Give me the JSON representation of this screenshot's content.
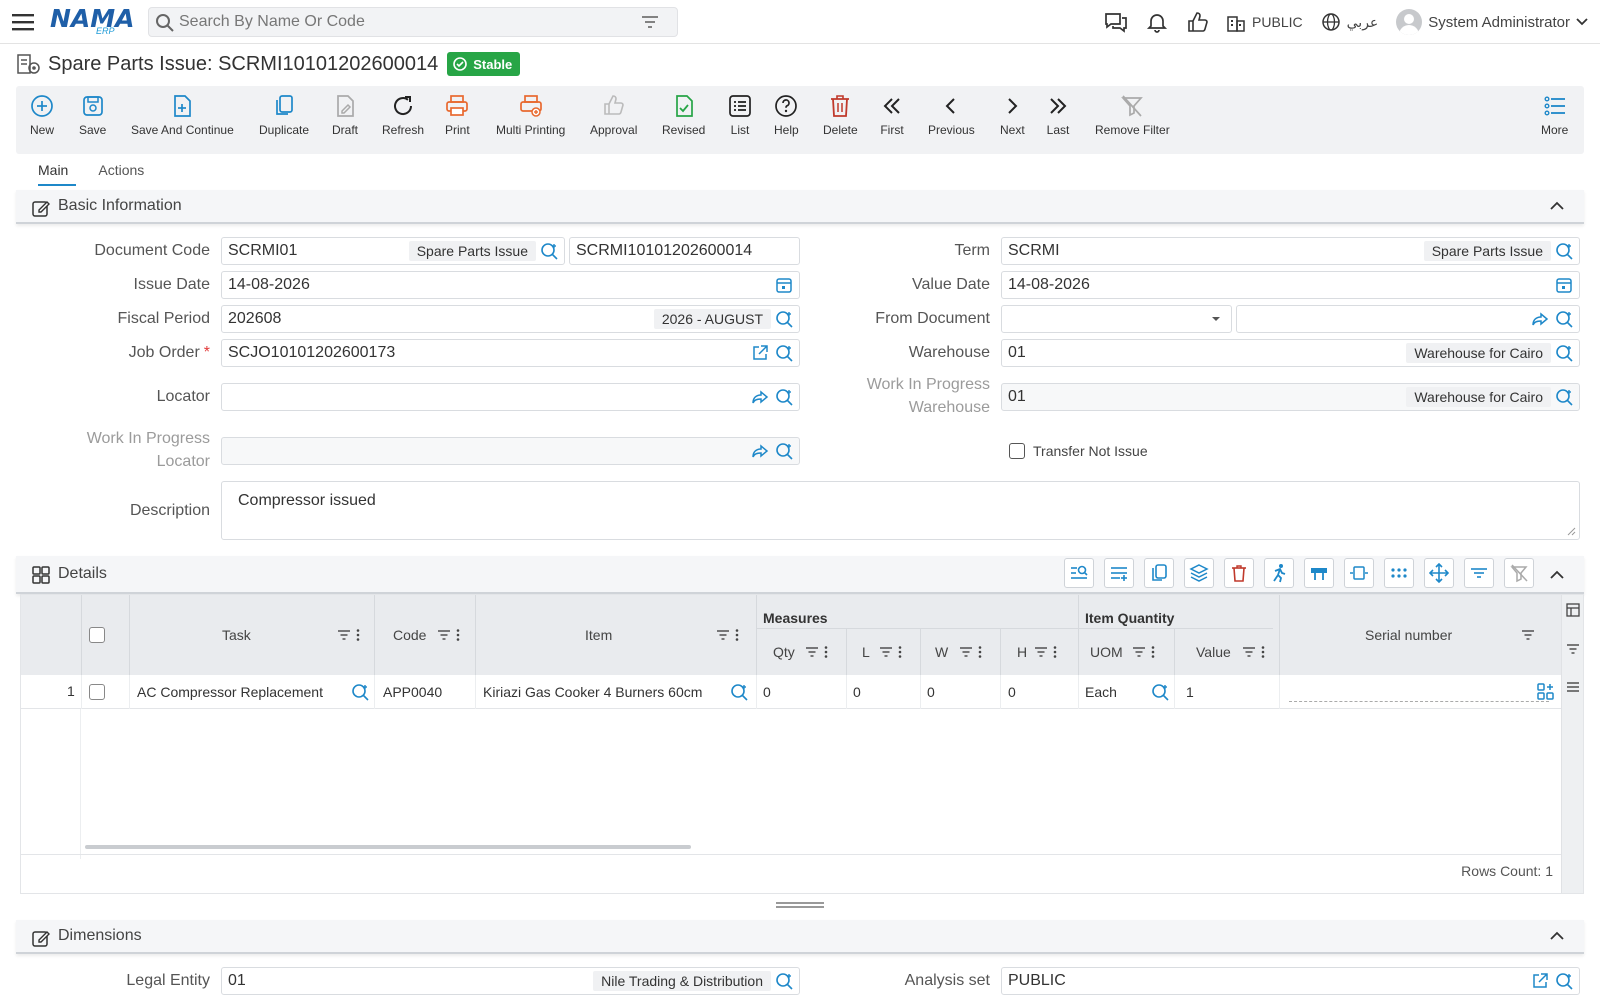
{
  "colors": {
    "accent": "#1e88c9",
    "status_green": "#27a546",
    "print_orange": "#e8692f",
    "delete_red": "#c0392b"
  },
  "header": {
    "logo_text": "NAMA",
    "logo_sub": "ERP",
    "search_placeholder": "Search By Name Or Code",
    "public_label": "PUBLIC",
    "language_label": "عربي",
    "user_name": "System Administrator"
  },
  "page": {
    "title": "Spare Parts Issue: SCRMI10101202600014",
    "status": "Stable"
  },
  "toolbar": {
    "new": "New",
    "save": "Save",
    "save_continue": "Save And Continue",
    "duplicate": "Duplicate",
    "draft": "Draft",
    "refresh": "Refresh",
    "print": "Print",
    "multi_printing": "Multi Printing",
    "approval": "Approval",
    "revised": "Revised",
    "list": "List",
    "help": "Help",
    "delete": "Delete",
    "first": "First",
    "previous": "Previous",
    "next": "Next",
    "last": "Last",
    "remove_filter": "Remove Filter",
    "more": "More"
  },
  "tabs": {
    "main": "Main",
    "actions": "Actions"
  },
  "basic": {
    "title": "Basic Information",
    "document_code_label": "Document Code",
    "document_code": "SCRMI01",
    "document_code_desc": "Spare Parts Issue",
    "document_number": "SCRMI10101202600014",
    "term_label": "Term",
    "term": "SCRMI",
    "term_desc": "Spare Parts Issue",
    "issue_date_label": "Issue Date",
    "issue_date": "14-08-2026",
    "value_date_label": "Value Date",
    "value_date": "14-08-2026",
    "fiscal_period_label": "Fiscal Period",
    "fiscal_period": "202608",
    "fiscal_period_desc": "2026 - AUGUST",
    "from_document_label": "From Document",
    "job_order_label": "Job Order",
    "job_order": "SCJO10101202600173",
    "warehouse_label": "Warehouse",
    "warehouse": "01",
    "warehouse_desc": "Warehouse for Cairo",
    "locator_label": "Locator",
    "wip_warehouse_label_1": "Work In Progress",
    "wip_warehouse_label_2": "Warehouse",
    "wip_warehouse": "01",
    "wip_warehouse_desc": "Warehouse for Cairo",
    "wip_locator_label_1": "Work In Progress",
    "wip_locator_label_2": "Locator",
    "transfer_not_issue_label": "Transfer Not Issue",
    "description_label": "Description",
    "description": "Compressor issued"
  },
  "details": {
    "title": "Details",
    "headers": {
      "task": "Task",
      "code": "Code",
      "item": "Item",
      "measures": "Measures",
      "qty": "Qty",
      "l": "L",
      "w": "W",
      "h": "H",
      "item_quantity": "Item Quantity",
      "uom": "UOM",
      "value": "Value",
      "serial": "Serial number"
    },
    "rows": [
      {
        "num": "1",
        "task": "AC Compressor Replacement",
        "code": "APP0040",
        "item": "Kiriazi Gas Cooker 4 Burners 60cm",
        "qty": "0",
        "l": "0",
        "w": "0",
        "h": "0",
        "uom": "Each",
        "value": "1",
        "serial": ""
      }
    ],
    "rows_count": "Rows Count: 1"
  },
  "dimensions": {
    "title": "Dimensions",
    "legal_entity_label": "Legal Entity",
    "legal_entity": "01",
    "legal_entity_desc": "Nile Trading & Distribution",
    "analysis_set_label": "Analysis set",
    "analysis_set": "PUBLIC"
  }
}
